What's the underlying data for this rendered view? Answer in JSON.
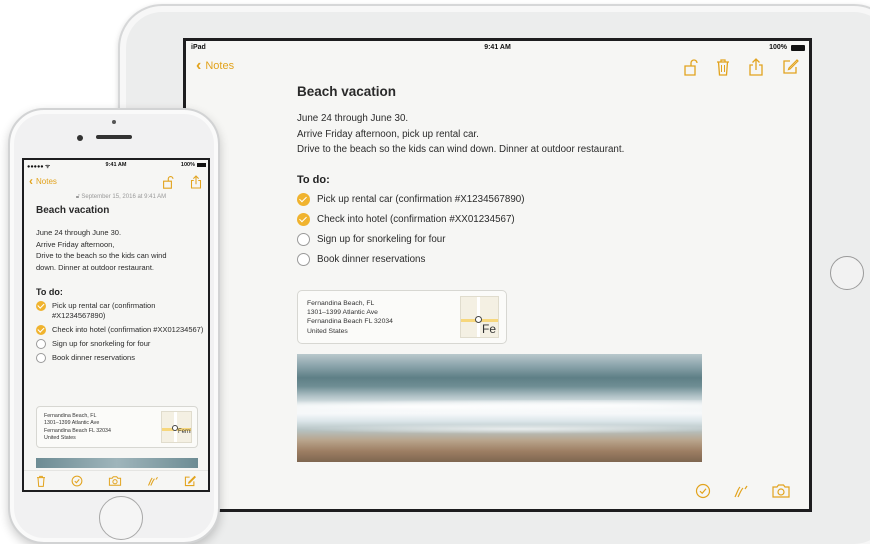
{
  "ipad": {
    "status": {
      "carrier": "iPad",
      "time": "9:41 AM",
      "battery": "100%"
    },
    "nav": {
      "back_label": "Notes",
      "icons": [
        "lock-icon",
        "trash-icon",
        "share-icon",
        "compose-icon"
      ]
    },
    "note": {
      "title": "Beach vacation",
      "body": [
        "June 24 through June 30.",
        "Arrive Friday afternoon, pick up rental car.",
        "Drive to the beach so the kids can wind down. Dinner at outdoor restaurant."
      ],
      "todo_heading": "To do:",
      "todos": [
        {
          "label": "Pick up rental car (confirmation #X1234567890)",
          "checked": true
        },
        {
          "label": "Check into hotel (confirmation #XX01234567)",
          "checked": true
        },
        {
          "label": "Sign up for snorkeling for four",
          "checked": false
        },
        {
          "label": "Book dinner reservations",
          "checked": false
        }
      ],
      "map_card": {
        "address": [
          "Fernandina Beach, FL",
          "1301–1399 Atlantic Ave",
          "Fernandina Beach FL 32034",
          "United States"
        ],
        "map_label": "Fe"
      }
    },
    "toolbar_icons": [
      "checklist-icon",
      "sketch-icon",
      "camera-icon"
    ]
  },
  "iphone": {
    "status": {
      "carrier": "●●●●● ᯤ",
      "time": "9:41 AM",
      "battery": "100%"
    },
    "nav": {
      "back_label": "Notes",
      "icons": [
        "lock-icon",
        "share-icon"
      ]
    },
    "note": {
      "date": "September 15, 2016 at 9:41 AM",
      "title": "Beach vacation",
      "body": [
        "June 24 through June 30.",
        "Arrive Friday afternoon,",
        "Drive to the beach so the kids can wind",
        "down. Dinner at outdoor restaurant."
      ],
      "todo_heading": "To do:",
      "todos": [
        {
          "label": "Pick up rental car (confirmation #X1234567890)",
          "checked": true
        },
        {
          "label": "Check into hotel (confirmation #XX01234567)",
          "checked": true
        },
        {
          "label": "Sign up for snorkeling for four",
          "checked": false
        },
        {
          "label": "Book dinner reservations",
          "checked": false
        }
      ],
      "map_card": {
        "address": [
          "Fernandina Beach, FL",
          "1301–1399 Atlantic Ave",
          "Fernandina Beach FL 32034",
          "United States"
        ],
        "map_label": "Ferni"
      }
    },
    "toolbar_icons": [
      "trash-icon",
      "checklist-icon",
      "camera-icon",
      "sketch-icon",
      "compose-icon"
    ]
  },
  "colors": {
    "accent": "#e2a31d",
    "check_fill": "#f0b32e",
    "paper": "#f6f6f4"
  }
}
